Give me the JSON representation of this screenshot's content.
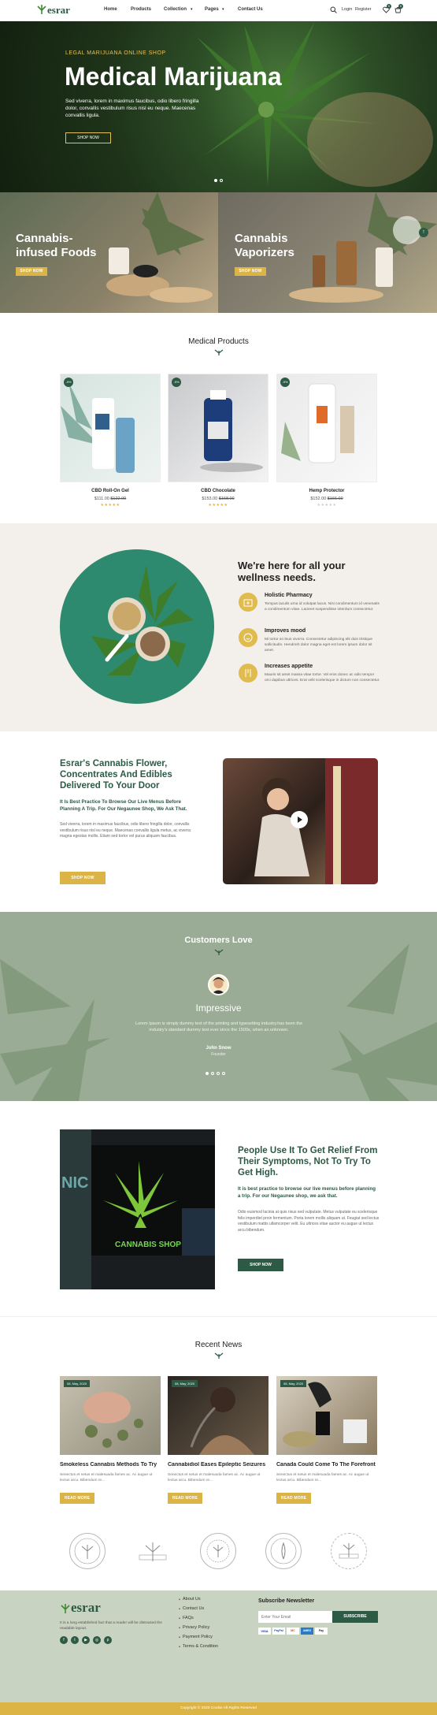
{
  "header": {
    "logo": "esrar",
    "nav": [
      "Home",
      "Products",
      "Collection",
      "Pages",
      "Contact Us"
    ],
    "login": "Login",
    "register": "Register",
    "cart_count": "0",
    "wish_count": "0"
  },
  "hero": {
    "eyebrow": "LEGAL MARIJUANA ONLINE SHOP",
    "title": "Medical Marijuana",
    "text": "Sed viverra, lorem in maximus faucibus, odio libero fringilla dolor, convallis vestibulum risus nisl eu neque. Maecenas convallis ligula.",
    "button": "SHOP NOW"
  },
  "banners": [
    {
      "title": "Cannabis-infused Foods",
      "button": "SHOP NOW"
    },
    {
      "title": "Cannabis Vaporizers",
      "button": "SHOP NOW"
    }
  ],
  "products": {
    "title": "Medical Products",
    "items": [
      {
        "badge": "-9%",
        "name": "CBD Roll-On Gel",
        "price": "$111.00",
        "old": "$122.00",
        "rating": 5,
        "stars": "★★★★★"
      },
      {
        "badge": "-9%",
        "name": "CBD Chocolate",
        "price": "$153.00",
        "old": "$168.00",
        "rating": 5,
        "stars": "★★★★★"
      },
      {
        "badge": "-9%",
        "name": "Hemp Protector",
        "price": "$152.00",
        "old": "$166.00",
        "rating": 0,
        "stars": "★★★★★"
      }
    ]
  },
  "wellness": {
    "title": "We're here for all your wellness needs.",
    "features": [
      {
        "title": "Holistic Pharmacy",
        "text": "Tempus iaculis urna id volutpat lacus. Nisi condimentum id venenatis a condimentum vitae. Laoreet suspendisse interdum consectetur."
      },
      {
        "title": "Improves mood",
        "text": "Mi tortor at risus viverra. Consectetur adipiscing elit duis tristique sollicitudin. Hendrerit dolor magna eget est lorem ipsum dolor sit amet."
      },
      {
        "title": "Increases appetite",
        "text": "Mauris sit amet massa vitae tortor. Vel eros donec ac odio tempor orci dapibus ultrices. Erat velit scelerisque in dictum non consectetur."
      }
    ]
  },
  "flower": {
    "title": "Esrar's Cannabis Flower, Concentrates And Edibles Delivered To Your Door",
    "subtitle": "It Is Best Practice To Browse Our Live Menus Before Planning A Trip. For Our Negaunee Shop, We Ask That.",
    "text": "Sed viverra, lorem in maximus faucibus, odio libero fringilla dolor, convallis vestibulum risus nisl eu neque. Maecenas convallis ligula metus, ac viverra magna egestas mollis. Etiam sed tortor vel purus aliquam faucibus.",
    "button": "SHOP NOW"
  },
  "testimonial": {
    "title": "Customers Love",
    "heading": "Impressive",
    "text": "Lorem Ipsum is simply dummy text of the printing and typesetting industry.has been the industry's standard dummy text ever since the 1500s, when an unknown.",
    "name": "John Snow",
    "role": "Founder"
  },
  "relief": {
    "title": "People Use It To Get Relief From Their Symptoms, Not To Try To Get High.",
    "subtitle": "It is best practice to browse our live menus before planning a trip. For our Negaunee shop, we ask that.",
    "text": "Odio euismod lacinia at quis risus sed vulputate. Metus vulputate eu scelerisque felis imperdiet proin fermentum. Porta lorem mollis aliquam ut. Feugiat sed lectus vestibulum mattis ullamcorper velit. Eu ultrices vitae auctor eu augue ut lectus arcu bibendum.",
    "button": "SHOP NOW",
    "sign_text": "CANNABIS SHOP",
    "side_text": "NIC"
  },
  "news": {
    "title": "Recent News",
    "items": [
      {
        "date": "08, May, 2020",
        "title": "Smokeless Cannabis Methods To Try",
        "text": "Senectus et netus et malesuada fames ac. Ac augue ut lectus arcu. Bibendum re...",
        "button": "READ MORE"
      },
      {
        "date": "08, May, 2020",
        "title": "Cannabidiol Eases Epileptic Seizures",
        "text": "Senectus et netus et malesuada fames ac. Ac augue ut lectus arcu. Bibendum re...",
        "button": "READ MORE"
      },
      {
        "date": "08, May, 2020",
        "title": "Canada Could Come To The Forefront",
        "text": "Senectus et netus et malesuada fames ac. Ac augue ut lectus arcu. Bibendum re...",
        "button": "READ MORE"
      }
    ]
  },
  "footer": {
    "logo": "esrar",
    "about": "It is a long established fact that a reader will be distracted the readable layout.",
    "links": [
      "About Us",
      "Contact Us",
      "FAQs",
      "Privacy Policy",
      "Payment Policy",
      "Terms & Condition"
    ],
    "newsletter_title": "Subscribe Newsletter",
    "newsletter_placeholder": "Enter Your Email",
    "subscribe": "SUBSCRIBE",
    "payments": [
      "VISA",
      "PayPal",
      "MC",
      "AMEX",
      "Pay"
    ],
    "copyright": "Copyright © 2020 Cookie All Rights Reserved"
  },
  "colors": {
    "accent": "#dcb445",
    "brand": "#2c5a45",
    "section_bg": "#f3efea",
    "testimonial_bg": "#9aac96"
  }
}
